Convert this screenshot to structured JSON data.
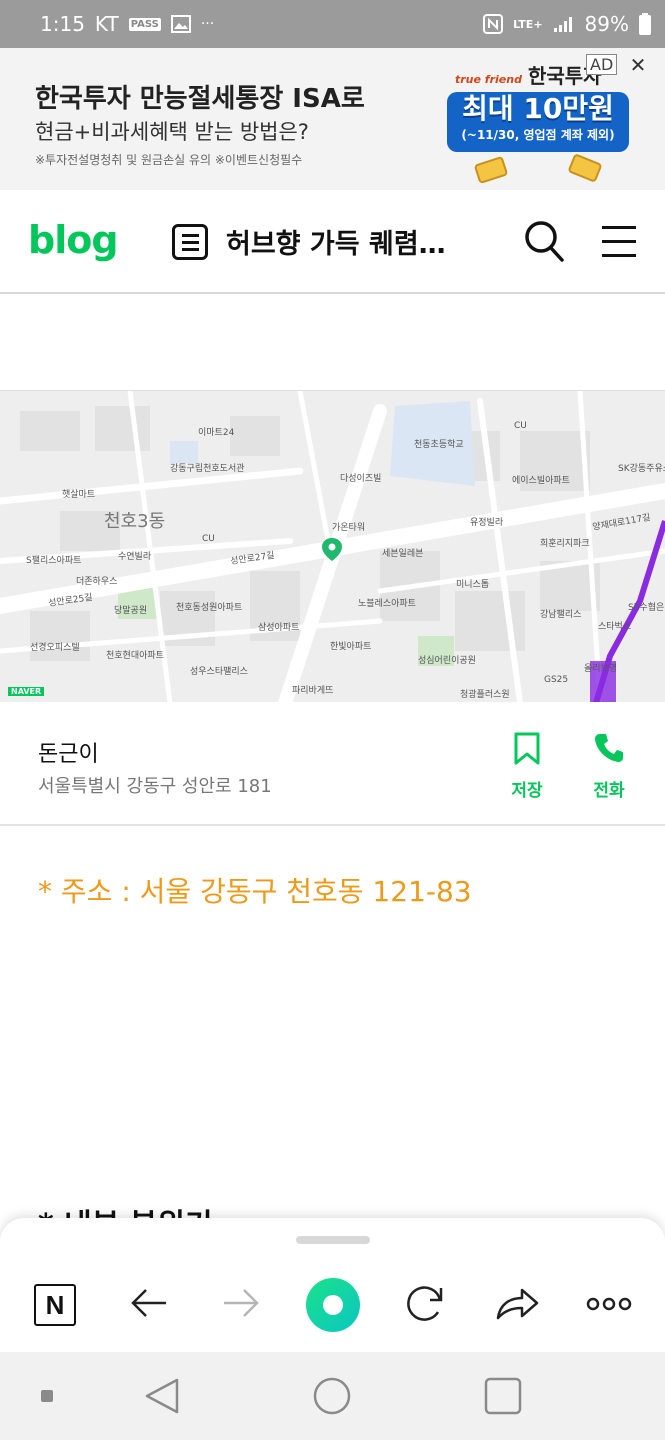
{
  "status_bar": {
    "time": "1:15",
    "carrier": "KT",
    "pass": "PASS",
    "network": "LTE+",
    "battery": "89%"
  },
  "ad": {
    "headline": "한국투자 만능절세통장 ISA로",
    "subline": "현금+비과세혜택 받는 방법은?",
    "note": "※투자전설명청취 및 원금손실 유의 ※이벤트신청필수",
    "brand_small": "true friend",
    "brand_name": "한국투자",
    "promo_main": "최대 10만원",
    "promo_sub": "(~11/30, 영업점 계좌 제외)",
    "label": "AD",
    "close": "✕"
  },
  "header": {
    "logo": "blog",
    "title": "허브향 가득 퀘렴…"
  },
  "map": {
    "area_label": "천호3동",
    "labels": [
      {
        "text": "이마트24"
      },
      {
        "text": "강동구립천호도서관"
      },
      {
        "text": "천동초등학교"
      },
      {
        "text": "다성이즈빌"
      },
      {
        "text": "햇살마트"
      },
      {
        "text": "가온타워"
      },
      {
        "text": "세븐일레븐"
      },
      {
        "text": "유정빌라"
      },
      {
        "text": "에이스빌아파트"
      },
      {
        "text": "희훈리지파크"
      },
      {
        "text": "SK강동주유소"
      },
      {
        "text": "수연빌라"
      },
      {
        "text": "S팰리스아파트"
      },
      {
        "text": "더존하우스"
      },
      {
        "text": "당말공원"
      },
      {
        "text": "천호동성원아파트"
      },
      {
        "text": "삼성아파트"
      },
      {
        "text": "노블레스아파트"
      },
      {
        "text": "미니스톱"
      },
      {
        "text": "강남팰리스"
      },
      {
        "text": "스타벅스"
      },
      {
        "text": "선경오피스텔"
      },
      {
        "text": "천호현대아파트"
      },
      {
        "text": "성우스타팰리스"
      },
      {
        "text": "한빛아파트"
      },
      {
        "text": "성심어린이공원"
      },
      {
        "text": "파리바게뜨"
      },
      {
        "text": "청광플러스원"
      },
      {
        "text": "GS25"
      },
      {
        "text": "올리브영"
      },
      {
        "text": "Sh수협은"
      },
      {
        "text": "CU"
      },
      {
        "text": "CU"
      },
      {
        "text": "성안로27길"
      },
      {
        "text": "성안로25길"
      },
      {
        "text": "양재대로117길"
      }
    ],
    "logo": "NAVER"
  },
  "place": {
    "name": "돈근이",
    "address": "서울특별시 강동구 성안로 181",
    "save_label": "저장",
    "call_label": "전화"
  },
  "content": {
    "address_line": "* 주소 : 서울 강동구 천호동 121-83",
    "cut_heading": "* 내부 분위기"
  },
  "toolbar": {
    "home": "N"
  },
  "colors": {
    "brand_green": "#03c75a",
    "address_orange": "#ee9a18",
    "status_gray": "#9b9b9b"
  }
}
